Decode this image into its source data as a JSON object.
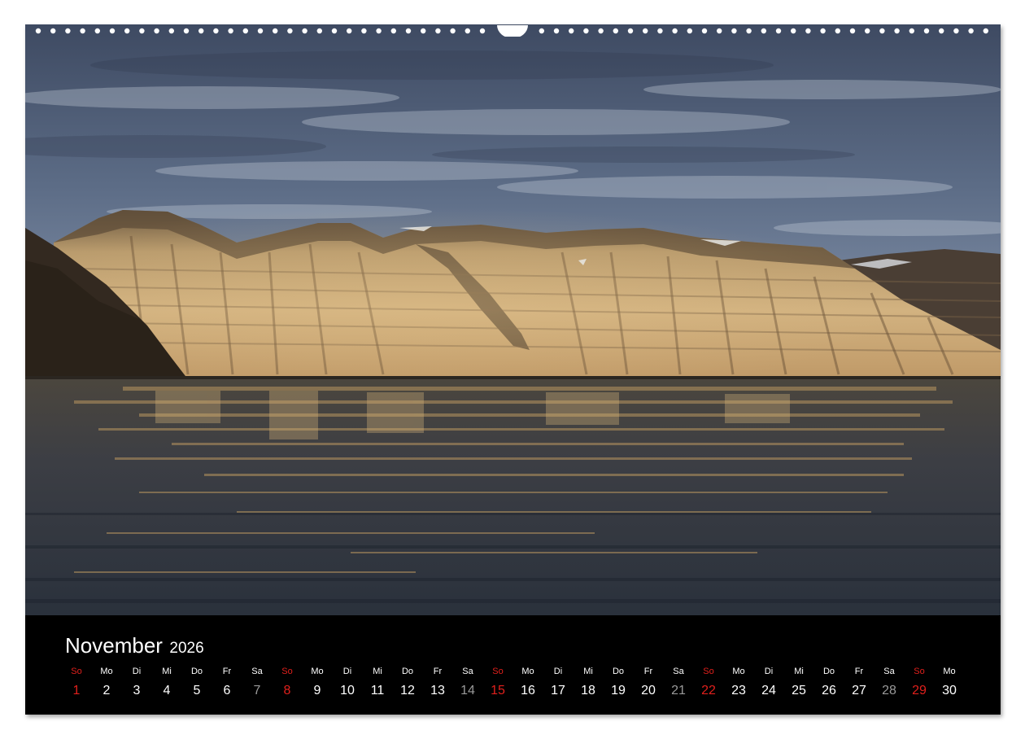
{
  "calendar": {
    "month": "November",
    "year": "2026",
    "days": [
      {
        "dow": "So",
        "num": "1",
        "sunday": true
      },
      {
        "dow": "Mo",
        "num": "2"
      },
      {
        "dow": "Di",
        "num": "3"
      },
      {
        "dow": "Mi",
        "num": "4"
      },
      {
        "dow": "Do",
        "num": "5"
      },
      {
        "dow": "Fr",
        "num": "6"
      },
      {
        "dow": "Sa",
        "num": "7",
        "saturday": true
      },
      {
        "dow": "So",
        "num": "8",
        "sunday": true
      },
      {
        "dow": "Mo",
        "num": "9"
      },
      {
        "dow": "Di",
        "num": "10"
      },
      {
        "dow": "Mi",
        "num": "11"
      },
      {
        "dow": "Do",
        "num": "12"
      },
      {
        "dow": "Fr",
        "num": "13"
      },
      {
        "dow": "Sa",
        "num": "14",
        "saturday": true
      },
      {
        "dow": "So",
        "num": "15",
        "sunday": true
      },
      {
        "dow": "Mo",
        "num": "16"
      },
      {
        "dow": "Di",
        "num": "17"
      },
      {
        "dow": "Mi",
        "num": "18"
      },
      {
        "dow": "Do",
        "num": "19"
      },
      {
        "dow": "Fr",
        "num": "20"
      },
      {
        "dow": "Sa",
        "num": "21",
        "saturday": true
      },
      {
        "dow": "So",
        "num": "22",
        "sunday": true
      },
      {
        "dow": "Mo",
        "num": "23"
      },
      {
        "dow": "Di",
        "num": "24"
      },
      {
        "dow": "Mi",
        "num": "25"
      },
      {
        "dow": "Do",
        "num": "26"
      },
      {
        "dow": "Fr",
        "num": "27"
      },
      {
        "dow": "Sa",
        "num": "28",
        "saturday": true
      },
      {
        "dow": "So",
        "num": "29",
        "sunday": true
      },
      {
        "dow": "Mo",
        "num": "30"
      }
    ]
  },
  "colors": {
    "sunday": "#e0201c",
    "saturday": "#9a9a9a",
    "weekday": "#ffffff",
    "background": "#000000"
  },
  "photo": {
    "subject": "sunlit layered arctic cliffs reflected in calm fjord water under cloudy sky"
  }
}
